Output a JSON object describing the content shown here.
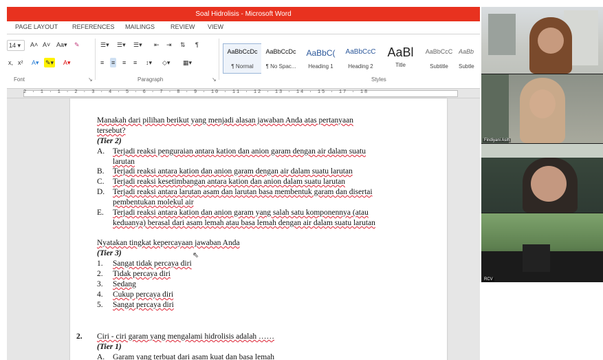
{
  "window": {
    "title": "Soal Hidrolisis - Microsoft Word",
    "accent": "#e8321f"
  },
  "tabs": [
    "PAGE LAYOUT",
    "REFERENCES",
    "MAILINGS",
    "REVIEW",
    "VIEW"
  ],
  "ribbon": {
    "font_size": "14",
    "group_font": "Font",
    "group_paragraph": "Paragraph",
    "group_styles": "Styles",
    "styles": [
      {
        "preview": "AaBbCcDc",
        "name": "¶ Normal"
      },
      {
        "preview": "AaBbCcDc",
        "name": "¶ No Spac..."
      },
      {
        "preview": "AaBbC(",
        "name": "Heading 1"
      },
      {
        "preview": "AaBbCcC",
        "name": "Heading 2"
      },
      {
        "preview": "AaBl",
        "name": "Title"
      },
      {
        "preview": "AaBbCcC",
        "name": "Subtitle"
      },
      {
        "preview": "AaBb",
        "name": "Subtle"
      }
    ]
  },
  "ruler": {
    "numbers": "2 · 1 · 1 · 2 · 3 · 4 · 5 · 6 · 7 · 8 · 9 · 10 · 11 · 12 · 13 · 14 · 15 · 17 · 18"
  },
  "document": {
    "q1_prompt_line1": "Manakah dari pilihan berikut yang menjadi alasan jawaban Anda atas pertanyaan",
    "q1_prompt_line2": "tersebut?",
    "tier2": "(Tier 2)",
    "options_tier2": [
      {
        "letter": "A.",
        "line1": "Terjadi reaksi penguraian antara kation dan anion garam dengan air dalam suatu",
        "line2": "larutan"
      },
      {
        "letter": "B.",
        "line1": "Terjadi reaksi antara kation dan anion garam dengan air dalam suatu larutan",
        "line2": ""
      },
      {
        "letter": "C.",
        "line1": "Terjadi reaksi kesetimbangan antara kation dan anion dalam suatu larutan",
        "line2": ""
      },
      {
        "letter": "D.",
        "line1": "Terjadi reaksi antara larutan asam dan larutan basa membentuk garam dan disertai",
        "line2": "pembentukan molekul air"
      },
      {
        "letter": "E.",
        "line1": "Terjadi reaksi antara kation dan anion garam yang salah satu komponennya (atau",
        "line2": "keduanya) berasal dari asam lemah atau basa lemah dengan air dalam suatu larutan"
      }
    ],
    "confidence_prompt": "Nyatakan  tingkat kepercayaan jawaban Anda",
    "tier3": "(Tier 3)",
    "confidence_options": [
      {
        "num": "1.",
        "text": "Sangat tidak percaya diri"
      },
      {
        "num": "2.",
        "text": "Tidak percaya diri"
      },
      {
        "num": "3.",
        "text": "Sedang"
      },
      {
        "num": "4.",
        "text": "Cukup percaya diri"
      },
      {
        "num": "5.",
        "text": "Sangat percaya diri"
      }
    ],
    "q2_number": "2.",
    "q2_prompt": "Ciri - ciri garam yang mengalami hidrolisis adalah ……",
    "tier1": "(Tier 1)",
    "q2_option_a_letter": "A.",
    "q2_option_a": "Garam yang terbuat dari asam kuat dan basa lemah"
  },
  "participants": [
    {
      "name": ""
    },
    {
      "name": "Findiyani Asih"
    },
    {
      "name": ""
    },
    {
      "name": "RCV"
    }
  ]
}
